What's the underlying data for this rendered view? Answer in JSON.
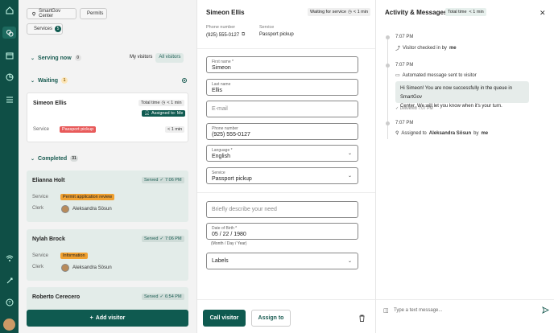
{
  "left": {
    "chips": {
      "location": "SmartGov Center",
      "category": "Permits",
      "services": "Services",
      "services_count": "5"
    },
    "serving": {
      "label": "Serving now",
      "count": "0"
    },
    "toggle": {
      "my": "My visitors",
      "all": "All visitors"
    },
    "waiting": {
      "label": "Waiting",
      "count": "1"
    },
    "waiting_card": {
      "name": "Simeon Ellis",
      "total_time": "Total time",
      "total_time_val": "< 1 min",
      "assigned": "Assigned to: Me",
      "service_label": "Service",
      "service": "Passport pickup",
      "wait": "< 1 min"
    },
    "completed": {
      "label": "Completed",
      "count": "31"
    },
    "completed_cards": [
      {
        "name": "Elianna Holt",
        "served": "Served",
        "time": "7:06 PM",
        "service_label": "Service",
        "service": "Permit application review",
        "clerk_label": "Clerk",
        "clerk": "Aleksandra Sösun"
      },
      {
        "name": "Nylah Brock",
        "served": "Served",
        "time": "7:06 PM",
        "service_label": "Service",
        "service": "Information",
        "clerk_label": "Clerk",
        "clerk": "Aleksandra Sösun"
      },
      {
        "name": "Roberto Cerecero",
        "served": "Served",
        "time": "6:54 PM"
      }
    ],
    "add_button": "Add visitor"
  },
  "detail": {
    "name": "Simeon Ellis",
    "status": "Waiting for service",
    "status_time": "< 1 min",
    "phone_label": "Phone number",
    "phone": "(925) 555-0127",
    "service_label": "Service",
    "service": "Passport pickup",
    "fields": {
      "first_name_label": "First name *",
      "first_name": "Simeon",
      "last_name_label": "Last name",
      "last_name": "Ellis",
      "email_placeholder": "E-mail",
      "phone_label": "Phone number",
      "phone": "(925) 555-0127",
      "language_label": "Language *",
      "language": "English",
      "service_label": "Service",
      "service": "Passport pickup",
      "need_placeholder": "Briefly describe your need",
      "dob_label": "Date of Birth *",
      "dob": "05 / 22 / 1980",
      "dob_hint": "(Month / Day / Year)",
      "labels_placeholder": "Labels"
    },
    "call_button": "Call visitor",
    "assign_button": "Assign to"
  },
  "activity": {
    "title": "Activity & Messages",
    "total_time": "Total time",
    "total_time_val": "< 1 min",
    "events": [
      {
        "time": "7:07 PM",
        "text": "Visitor checked in by",
        "who": "me"
      },
      {
        "time": "7:07 PM",
        "text": "Automated message sent to visitor"
      },
      {
        "time": "7:07 PM",
        "text": "Assigned to",
        "who": "Aleksandra Sösun",
        "by": "by",
        "by_who": "me"
      }
    ],
    "message_line1": "Hi Simeon! You are now successfully in the queue in SmartGov",
    "message_line2": "Center. We will let you know when it's your turn.",
    "delivered": "Delivered 7:07 PM",
    "input_placeholder": "Type a text message..."
  },
  "colors": {
    "brand": "#0f5a50",
    "tag_red": "#e85a5a",
    "tag_orange": "#f0a030"
  }
}
